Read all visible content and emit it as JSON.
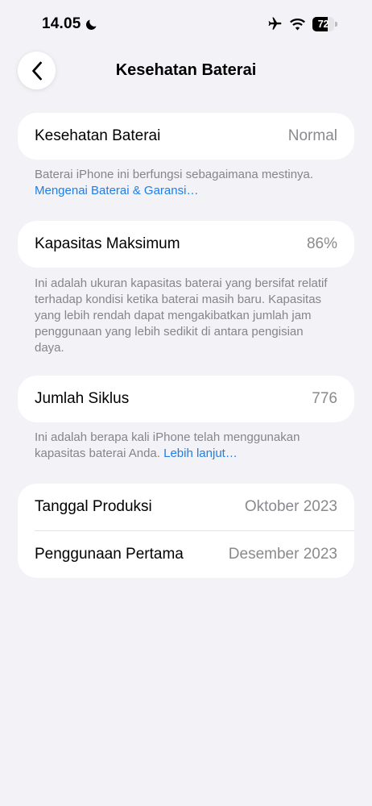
{
  "status_bar": {
    "time": "14.05",
    "focus_icon": "moon-icon",
    "airplane_icon": "airplane-icon",
    "wifi_icon": "wifi-icon",
    "battery_level": "72"
  },
  "nav": {
    "back_icon": "chevron-left-icon",
    "title": "Kesehatan Baterai"
  },
  "battery_health": {
    "label": "Kesehatan Baterai",
    "value": "Normal",
    "footnote": "Baterai iPhone ini berfungsi sebagaimana mestinya. ",
    "footnote_link": "Mengenai Baterai & Garansi…"
  },
  "max_capacity": {
    "label": "Kapasitas Maksimum",
    "value": "86%",
    "footnote": "Ini adalah ukuran kapasitas baterai yang bersifat relatif terhadap kondisi ketika baterai masih baru. Kapasitas yang lebih rendah dapat mengakibatkan jumlah jam penggunaan yang lebih sedikit di antara pengisian daya."
  },
  "cycle_count": {
    "label": "Jumlah Siklus",
    "value": "776",
    "footnote": "Ini adalah berapa kali iPhone telah menggunakan kapasitas baterai Anda. ",
    "footnote_link": "Lebih lanjut…"
  },
  "dates": {
    "manufacture_label": "Tanggal Produksi",
    "manufacture_value": "Oktober 2023",
    "first_use_label": "Penggunaan Pertama",
    "first_use_value": "Desember 2023"
  },
  "colors": {
    "background": "#f2f2f7",
    "card": "#ffffff",
    "link": "#1f7ee6",
    "secondary_text": "#8a8a8e"
  }
}
